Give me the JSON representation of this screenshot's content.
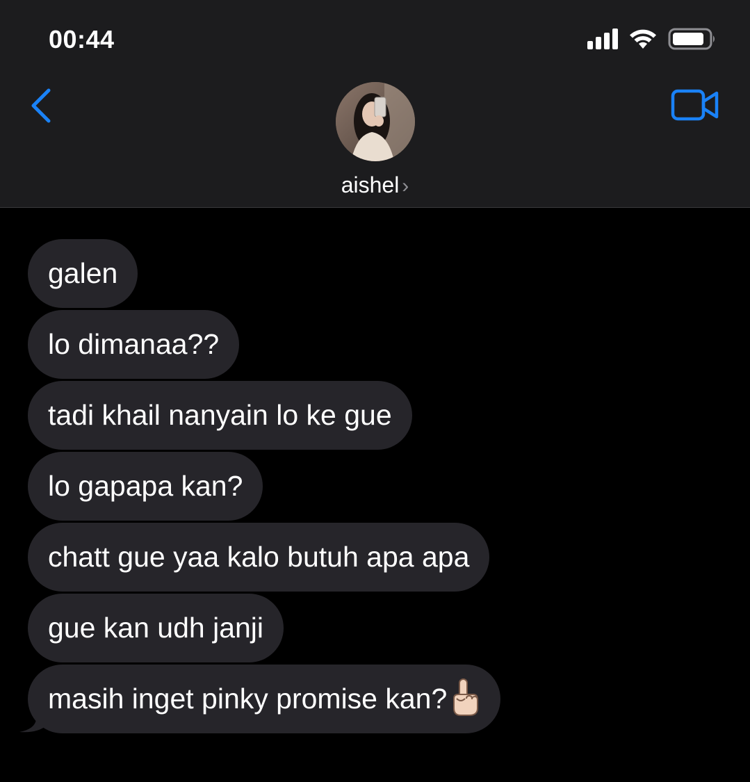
{
  "status_bar": {
    "time": "00:44",
    "icons": [
      "signal-icon",
      "wifi-icon",
      "battery-icon"
    ]
  },
  "header": {
    "back_icon": "chevron-left-icon",
    "video_icon": "video-camera-icon",
    "contact_name": "aishel",
    "contact_chevron": "›",
    "accent_color": "#1a82f7"
  },
  "messages": [
    {
      "text": "galen"
    },
    {
      "text": "lo dimanaa??"
    },
    {
      "text": "tadi khail nanyain lo ke gue"
    },
    {
      "text": "lo gapapa kan?"
    },
    {
      "text": "chatt gue yaa kalo butuh apa apa"
    },
    {
      "text": "gue kan udh janji"
    },
    {
      "text": "masih inget pinky promise kan?",
      "emoji": "pointing-up-emoji"
    }
  ],
  "colors": {
    "background": "#000000",
    "header_bg": "#1c1c1e",
    "bubble_bg": "#26252a",
    "text": "#ffffff"
  }
}
